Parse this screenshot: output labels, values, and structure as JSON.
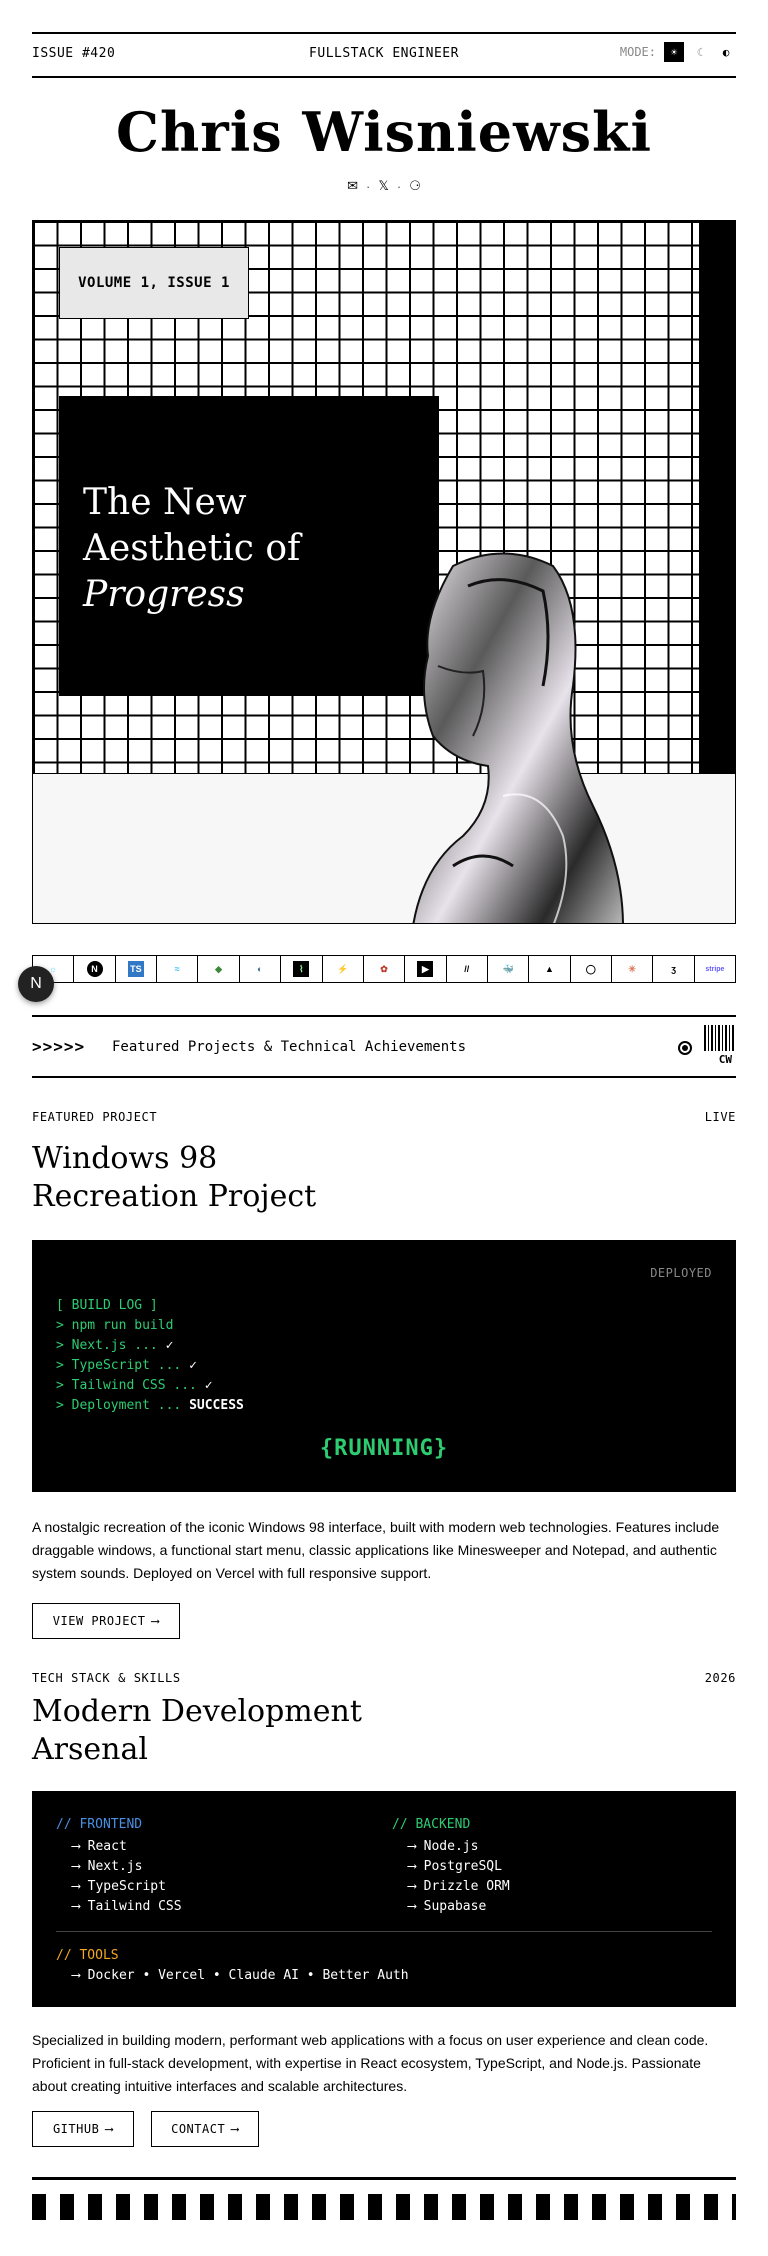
{
  "topbar": {
    "issue": "ISSUE #420",
    "role": "FULLSTACK ENGINEER",
    "mode_label": "MODE:",
    "mode_options": [
      "☀",
      "☾",
      "◐"
    ]
  },
  "masthead": {
    "name": "Chris Wisniewski"
  },
  "socials": {
    "items": [
      "✉",
      "𝕏",
      "⚆"
    ],
    "separator": "·"
  },
  "hero": {
    "volume": "VOLUME 1, ISSUE 1",
    "title_line1": "The New",
    "title_line2": "Aesthetic of",
    "title_line3": "Progress"
  },
  "tech_strip": {
    "items": [
      "☼",
      "N",
      "TS",
      "≈",
      "◆",
      "◐",
      "⌇",
      "⚡",
      "✿",
      "▶",
      "//",
      "🐳",
      "▲",
      "◯",
      "✳",
      "ʒ",
      "stripe"
    ]
  },
  "floating": {
    "label": "N"
  },
  "featured_bar": {
    "arrows": ">>>>>",
    "text": "Featured Projects & Technical Achievements",
    "badge": "CW"
  },
  "project": {
    "label": "FEATURED PROJECT",
    "status": "LIVE",
    "title_line1": "Windows 98",
    "title_line2": "Recreation Project",
    "terminal": {
      "deployed": "DEPLOYED",
      "log_header": "[ BUILD LOG ]",
      "line1": "> npm run build",
      "line2_text": "> Next.js ... ",
      "line3_text": "> TypeScript ... ",
      "line4_text": "> Tailwind CSS ... ",
      "check": "✓",
      "line5_text": "> Deployment ... ",
      "line5_result": "SUCCESS",
      "running": "{RUNNING}"
    },
    "description": "A nostalgic recreation of the iconic Windows 98 interface, built with modern web technologies. Features include draggable windows, a functional start menu, classic applications like Minesweeper and Notepad, and authentic system sounds. Deployed on Vercel with full responsive support.",
    "button": "VIEW PROJECT",
    "button_arrow": "⟶"
  },
  "stack": {
    "label": "TECH STACK & SKILLS",
    "year": "2026",
    "title_line1": "Modern Development",
    "title_line2": "Arsenal",
    "frontend_header": "// FRONTEND",
    "frontend": [
      "React",
      "Next.js",
      "TypeScript",
      "Tailwind CSS"
    ],
    "backend_header": "// BACKEND",
    "backend": [
      "Node.js",
      "PostgreSQL",
      "Drizzle ORM",
      "Supabase"
    ],
    "tools_header": "// TOOLS",
    "tools": "Docker • Vercel • Claude AI • Better Auth",
    "arrow": "⟶",
    "colors": {
      "frontend": "#4a90e2",
      "backend": "#2ecc71",
      "tools": "#f5a623"
    },
    "description": "Specialized in building modern, performant web applications with a focus on user experience and clean code. Proficient in full-stack development, with expertise in React ecosystem, TypeScript, and Node.js. Passionate about creating intuitive interfaces and scalable architectures.",
    "github_button": "GITHUB",
    "contact_button": "CONTACT"
  }
}
